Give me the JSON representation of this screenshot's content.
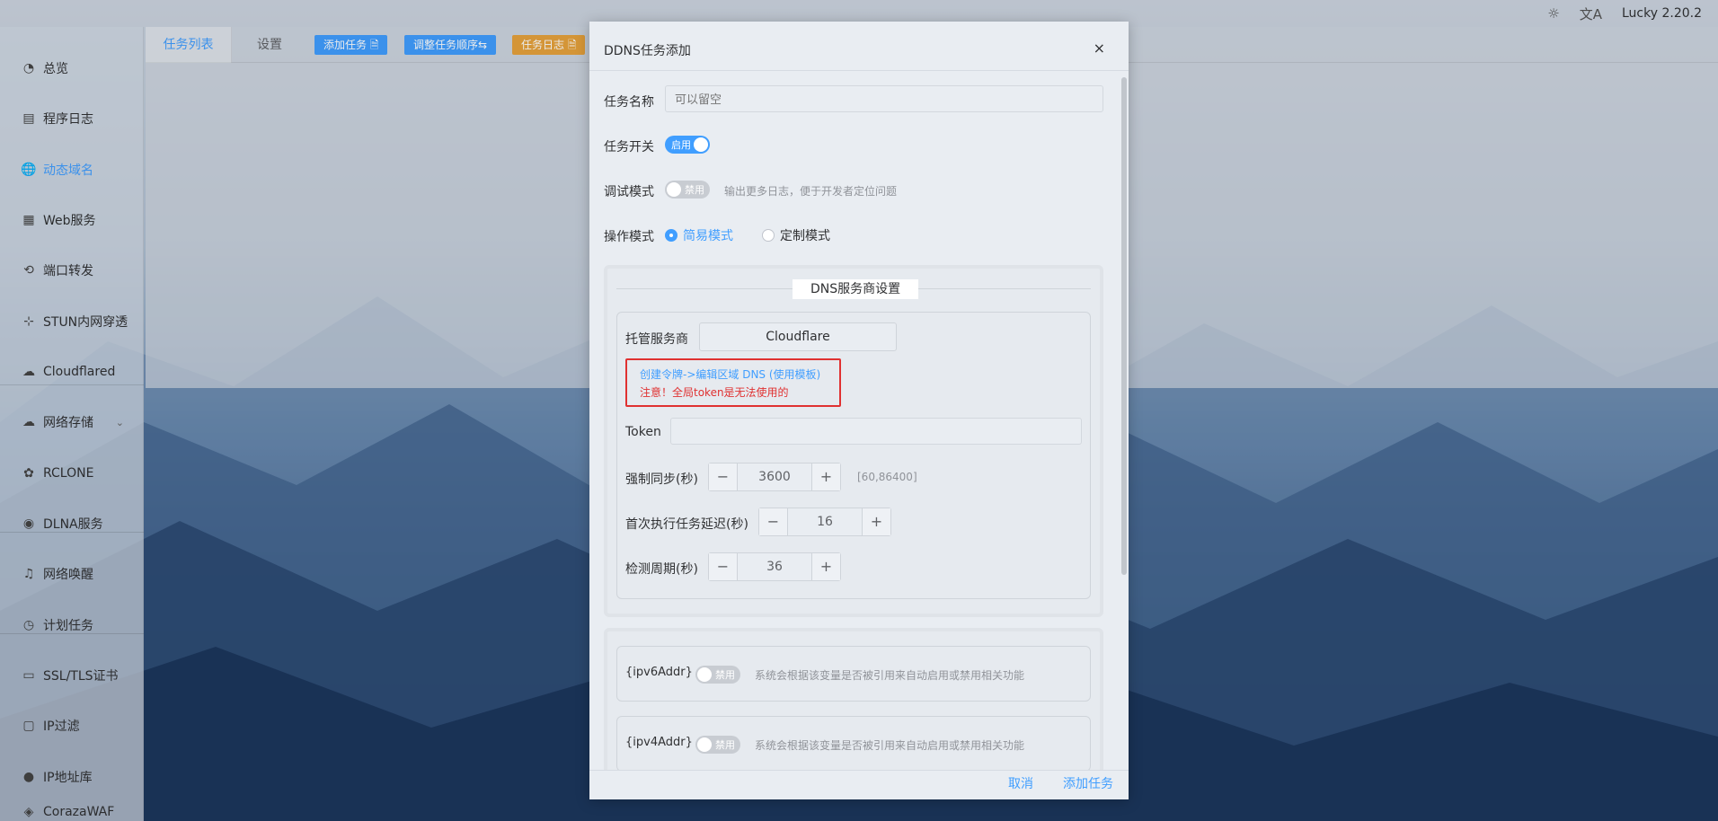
{
  "header": {
    "theme_icon": "sun-icon",
    "translate_icon": "translate-icon",
    "version": "Lucky 2.20.2"
  },
  "sidebar": {
    "items": [
      {
        "label": "总览",
        "icon": "dashboard-icon"
      },
      {
        "label": "程序日志",
        "icon": "log-icon"
      },
      {
        "label": "动态域名",
        "icon": "globe-icon"
      },
      {
        "label": "Web服务",
        "icon": "web-icon"
      },
      {
        "label": "端口转发",
        "icon": "port-icon"
      },
      {
        "label": "STUN内网穿透",
        "icon": "stun-icon"
      },
      {
        "label": "Cloudflared",
        "icon": "cloud-icon"
      },
      {
        "label": "网络存储",
        "icon": "storage-icon"
      },
      {
        "label": "RCLONE",
        "icon": "rclone-icon"
      },
      {
        "label": "DLNA服务",
        "icon": "dlna-icon"
      },
      {
        "label": "网络唤醒",
        "icon": "bell-icon"
      },
      {
        "label": "计划任务",
        "icon": "clock-icon"
      },
      {
        "label": "SSL/TLS证书",
        "icon": "certificate-icon"
      },
      {
        "label": "IP过滤",
        "icon": "filter-icon"
      },
      {
        "label": "IP地址库",
        "icon": "user-icon"
      },
      {
        "label": "CorazaWAF",
        "icon": "shield-icon"
      }
    ]
  },
  "main": {
    "tabs": [
      {
        "label": "任务列表"
      },
      {
        "label": "设置"
      }
    ],
    "buttons": {
      "add": "添加任务 🗎",
      "reorder": "调整任务顺序⇆",
      "log": "任务日志 🗎"
    }
  },
  "dialog": {
    "title": "DDNS任务添加",
    "close": "×",
    "task_name": {
      "label": "任务名称",
      "placeholder": "可以留空"
    },
    "task_switch": {
      "label": "任务开关",
      "state": "启用"
    },
    "debug": {
      "label": "调试模式",
      "state": "禁用",
      "hint": "输出更多日志，便于开发者定位问题"
    },
    "mode": {
      "label": "操作模式",
      "options": [
        "简易模式",
        "定制模式"
      ],
      "selected": "简易模式"
    },
    "dns": {
      "section_title": "DNS服务商设置",
      "provider_label": "托管服务商",
      "provider_value": "Cloudflare",
      "link": "创建令牌->编辑区域 DNS (使用模板)",
      "warning": "注意！全局token是无法使用的",
      "token_label": "Token",
      "force_sync": {
        "label": "强制同步(秒)",
        "value": "3600",
        "range": "[60,86400]"
      },
      "first_delay": {
        "label": "首次执行任务延迟(秒)",
        "value": "16"
      },
      "check_period": {
        "label": "检测周期(秒)",
        "value": "36"
      }
    },
    "vars": [
      {
        "name": "{ipv6Addr}",
        "state": "禁用",
        "hint": "系统会根据该变量是否被引用来自动启用或禁用相关功能"
      },
      {
        "name": "{ipv4Addr}",
        "state": "禁用",
        "hint": "系统会根据该变量是否被引用来自动启用或禁用相关功能"
      }
    ],
    "footer": {
      "cancel": "取消",
      "confirm": "添加任务"
    }
  },
  "colors": {
    "accent": "#409eff",
    "warning": "#e03131",
    "orange": "#e6a23c"
  }
}
